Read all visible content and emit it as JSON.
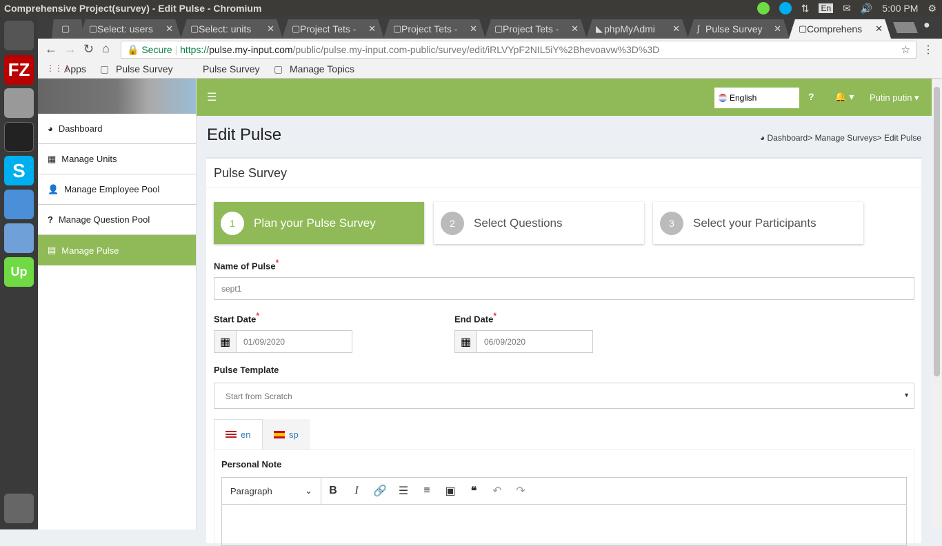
{
  "os": {
    "window_title": "Comprehensive Project(survey) - Edit Pulse - Chromium",
    "clock": "5:00 PM",
    "keyboard": "En"
  },
  "tabs": [
    {
      "label": ""
    },
    {
      "label": "Select: users"
    },
    {
      "label": "Select: units"
    },
    {
      "label": "Project Tets -"
    },
    {
      "label": "Project Tets -"
    },
    {
      "label": "Project Tets -"
    },
    {
      "label": "phpMyAdmi"
    },
    {
      "label": "Pulse Survey"
    },
    {
      "label": "Comprehens"
    }
  ],
  "omnibar": {
    "secure": "Secure",
    "url_scheme": "https://",
    "url_host": "pulse.my-input.com",
    "url_path": "/public/pulse.my-input.com-public/survey/edit/iRLVYpF2NIL5iY%2Bhevoavw%3D%3D"
  },
  "bookmarks": [
    "Apps",
    "Pulse Survey",
    "Pulse Survey",
    "Manage Topics"
  ],
  "sidebar": {
    "items": [
      {
        "label": "Dashboard",
        "icon": "dashboard-icon"
      },
      {
        "label": "Manage Units",
        "icon": "grid-icon"
      },
      {
        "label": "Manage Employee Pool",
        "icon": "user-icon"
      },
      {
        "label": "Manage Question Pool",
        "icon": "question-icon"
      },
      {
        "label": "Manage Pulse",
        "icon": "list-icon"
      }
    ]
  },
  "header": {
    "language": "English",
    "user": "Putin putin"
  },
  "page": {
    "title": "Edit Pulse",
    "breadcrumb": [
      "Dashboard>",
      "Manage Surveys>",
      "Edit Pulse"
    ],
    "card_title": "Pulse Survey"
  },
  "steps": [
    {
      "num": "1",
      "label": "Plan your Pulse Survey"
    },
    {
      "num": "2",
      "label": "Select Questions"
    },
    {
      "num": "3",
      "label": "Select your Participants"
    }
  ],
  "form": {
    "name_label": "Name of Pulse",
    "name_value": "sept1",
    "start_label": "Start Date",
    "start_value": "01/09/2020",
    "end_label": "End Date",
    "end_value": "06/09/2020",
    "template_label": "Pulse Template",
    "template_value": "Start from Scratch",
    "lang_tabs": [
      "en",
      "sp"
    ],
    "note_label": "Personal Note",
    "paragraph": "Paragraph"
  },
  "colors": {
    "accent": "#8fba57"
  }
}
